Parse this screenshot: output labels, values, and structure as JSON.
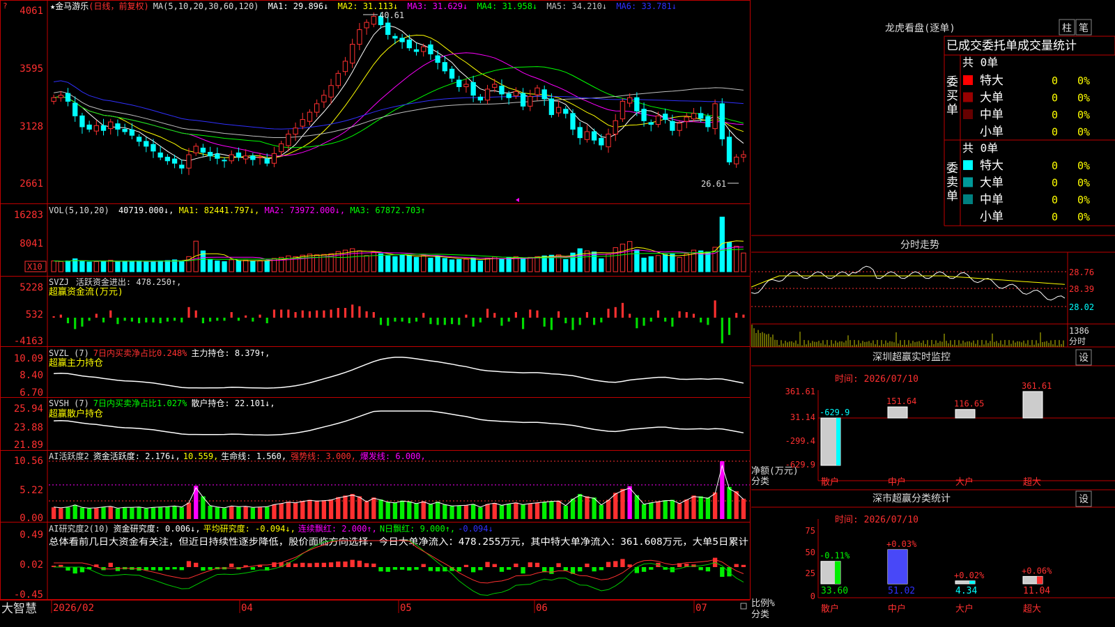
{
  "header": {
    "stock_name": "★金马游乐",
    "mode": "(日线，前复权)",
    "ma_prefix": "MA(5,10,20,30,60,120)",
    "ma": [
      {
        "label": "MA1: 29.896↓",
        "color": "#ffffff"
      },
      {
        "label": "MA2: 31.113↓",
        "color": "#ffff00"
      },
      {
        "label": "MA3: 31.629↓",
        "color": "#ff00ff"
      },
      {
        "label": "MA4: 31.958↓",
        "color": "#00ff00"
      },
      {
        "label": "MA5: 34.210↓",
        "color": "#c0c0c0"
      },
      {
        "label": "MA6: 33.781↓",
        "color": "#3030ff"
      }
    ]
  },
  "price_panel": {
    "y_ticks": [
      "4061",
      "3595",
      "3128",
      "2661"
    ],
    "high_label": "40.61",
    "low_label": "26.61"
  },
  "vol_panel": {
    "title": "VOL(5,10,20)",
    "value": "40719.000↓,",
    "ma1": "MA1: 82441.797↓,",
    "ma2": "MA2: 73972.000↓,",
    "ma3": "MA3: 67872.703↑",
    "y_ticks": [
      "16283",
      "8041"
    ],
    "scale_label": "X10"
  },
  "svzj_panel": {
    "title": "SVZJ",
    "line1": "活跃资金进出: 478.250↑,",
    "line2": "超赢资金流(万元)",
    "y_ticks": [
      "5228",
      "532",
      "-4163"
    ]
  },
  "svzl_panel": {
    "title": "SVZL (7)",
    "ratio": "7日内买卖净占比0.248%",
    "hold": "主力持仓: 8.379↑,",
    "line2": "超赢主力持仓",
    "y_ticks": [
      "10.09",
      "8.40",
      "6.70"
    ]
  },
  "svsh_panel": {
    "title": "SVSH (7)",
    "ratio": "7日内买卖净占比1.027%",
    "hold": "散户持仓: 22.101↓,",
    "line2": "超赢散户持仓",
    "y_ticks": [
      "25.94",
      "23.88",
      "21.89"
    ]
  },
  "ai_panel": {
    "title": "AI活跃度2",
    "active": "资金活跃度: 2.176↓,",
    "v2": "10.559,",
    "life": "生命线: 1.560,",
    "strong": "强势线: 3.000,",
    "burst": "爆发线: 6.000,",
    "y_ticks": [
      "10.56",
      "5.22",
      "0.00"
    ]
  },
  "research_panel": {
    "title": "AI研究度2(10)",
    "research": "资金研究度: 0.006↓,",
    "avg": "平均研究度: -0.094↓,",
    "red": "连续飘红: 2.000↑,",
    "nred": "N日飘红: 9.000↑,",
    "last": "-0.094↓",
    "comment": "总体看前几日大资金有关注，但近日持续性逐步降低，股价面临方向选择，今日大单净流入：478.255万元，其中特大单净流入：361.608万元，大单5日累计",
    "y_ticks": [
      "0.49",
      "0.02",
      "-0.45"
    ]
  },
  "bottom_axis": {
    "brand": "大智慧",
    "months": [
      "2026/02",
      "04",
      "05",
      "06",
      "07"
    ]
  },
  "longhu": {
    "title": "龙虎看盘(逐单)",
    "btn_zhu": "柱",
    "btn_bi": "笔",
    "subtitle": "已成交委托单成交量统计",
    "buy_label": "委买单",
    "sell_label": "委卖单",
    "buy_total": "共 0单",
    "sell_total": "共 0单",
    "rows": [
      {
        "name": "特大",
        "qty": "0",
        "pct": "0%"
      },
      {
        "name": "大单",
        "qty": "0",
        "pct": "0%"
      },
      {
        "name": "中单",
        "qty": "0",
        "pct": "0%"
      },
      {
        "name": "小单",
        "qty": "0",
        "pct": "0%"
      }
    ],
    "buy_colors": [
      "#ff0000",
      "#990000",
      "#660000",
      "#000000"
    ],
    "sell_colors": [
      "#00ffff",
      "#009999",
      "#008080",
      "#000000"
    ]
  },
  "intraday": {
    "title": "分时走势",
    "prices": [
      "28.76",
      "28.39",
      "28.02"
    ],
    "volume": "1386",
    "vol_unit": "分时"
  },
  "sz_monitor": {
    "title": "深圳超赢实时监控",
    "set_btn": "设",
    "time": "时间: 2026/07/10",
    "y_ticks": [
      "361.61",
      "31.14",
      "-299.4",
      "-629.9"
    ],
    "y_label1": "净额(万元)",
    "y_label2": "分类",
    "categories": [
      "散户",
      "中户",
      "大户",
      "超大"
    ],
    "values": [
      -629.9,
      151.64,
      116.65,
      361.61
    ],
    "value_labels": [
      "-629.9",
      "151.64",
      "116.65",
      "361.61"
    ]
  },
  "sz_class": {
    "title": "深市超赢分类统计",
    "set_btn": "设",
    "time": "时间: 2026/07/10",
    "y_ticks": [
      "75",
      "50",
      "25",
      "0"
    ],
    "y_label1": "比例%",
    "y_label2": "分类",
    "categories": [
      "散户",
      "中户",
      "大户",
      "超大"
    ],
    "ratios": [
      33.6,
      51.02,
      4.34,
      11.04
    ],
    "ratio_labels": [
      "33.60",
      "51.02",
      "4.34",
      "11.04"
    ],
    "change_labels": [
      "-0.11%",
      "+0.03%",
      "+0.02%",
      "+0.06%"
    ]
  },
  "chart_data": {
    "type": "candlestick",
    "title": "金马游乐 日线 前复权",
    "x_months": [
      "2026/02",
      "04",
      "05",
      "06",
      "07"
    ],
    "ylim": [
      26.61,
      40.61
    ],
    "close": [
      33.6,
      33.8,
      33.3,
      32.1,
      31.2,
      31.0,
      31.3,
      30.9,
      31.6,
      31.0,
      30.8,
      30.5,
      30.0,
      29.6,
      29.2,
      28.7,
      28.4,
      28.2,
      27.8,
      28.9,
      29.6,
      29.1,
      28.8,
      28.6,
      28.4,
      28.9,
      28.7,
      28.8,
      28.5,
      28.7,
      28.2,
      29.0,
      29.8,
      30.6,
      31.1,
      31.8,
      32.4,
      33.1,
      33.8,
      34.6,
      35.6,
      36.6,
      38.0,
      39.2,
      39.8,
      40.3,
      39.6,
      38.8,
      38.5,
      38.2,
      37.7,
      37.4,
      37.8,
      37.2,
      36.5,
      35.8,
      35.2,
      34.5,
      34.7,
      33.8,
      33.4,
      34.3,
      34.7,
      33.9,
      33.6,
      34.1,
      32.9,
      33.7,
      34.4,
      33.5,
      32.2,
      32.8,
      32.3,
      31.0,
      30.3,
      30.8,
      30.1,
      29.7,
      30.6,
      31.7,
      33.3,
      33.6,
      32.5,
      31.7,
      31.4,
      32.1,
      31.8,
      30.9,
      31.5,
      32.0,
      32.3,
      31.9,
      31.2,
      33.1,
      30.2,
      28.3,
      28.7,
      28.9
    ],
    "volume": [
      30,
      28,
      30,
      36,
      29,
      27,
      28,
      30,
      32,
      27,
      29,
      29,
      30,
      27,
      29,
      30,
      31,
      33,
      30,
      42,
      85,
      58,
      34,
      30,
      28,
      33,
      31,
      32,
      29,
      30,
      31,
      37,
      40,
      44,
      42,
      46,
      49,
      47,
      48,
      50,
      56,
      60,
      64,
      58,
      45,
      55,
      50,
      44,
      42,
      47,
      45,
      40,
      45,
      38,
      44,
      37,
      33,
      34,
      35,
      38,
      30,
      38,
      41,
      35,
      39,
      42,
      37,
      40,
      42,
      44,
      46,
      47,
      34,
      52,
      64,
      58,
      55,
      36,
      49,
      67,
      77,
      84,
      61,
      38,
      42,
      45,
      48,
      49,
      40,
      50,
      60,
      58,
      55,
      68,
      152,
      82,
      71,
      52
    ],
    "volume_ylim": [
      0,
      162830
    ],
    "indicators": [
      {
        "name": "MA1",
        "value": 29.896
      },
      {
        "name": "MA2",
        "value": 31.113
      },
      {
        "name": "MA3",
        "value": 31.629
      },
      {
        "name": "MA4",
        "value": 31.958
      },
      {
        "name": "MA5",
        "value": 34.21
      },
      {
        "name": "MA6",
        "value": 33.781
      }
    ],
    "svzj_ylim": [
      -4163,
      5228
    ],
    "svzl_ylim": [
      6.7,
      10.09
    ],
    "svsh_ylim": [
      21.89,
      25.94
    ],
    "ai_ylim": [
      0,
      10.56
    ],
    "research_ylim": [
      -0.45,
      0.49
    ]
  }
}
